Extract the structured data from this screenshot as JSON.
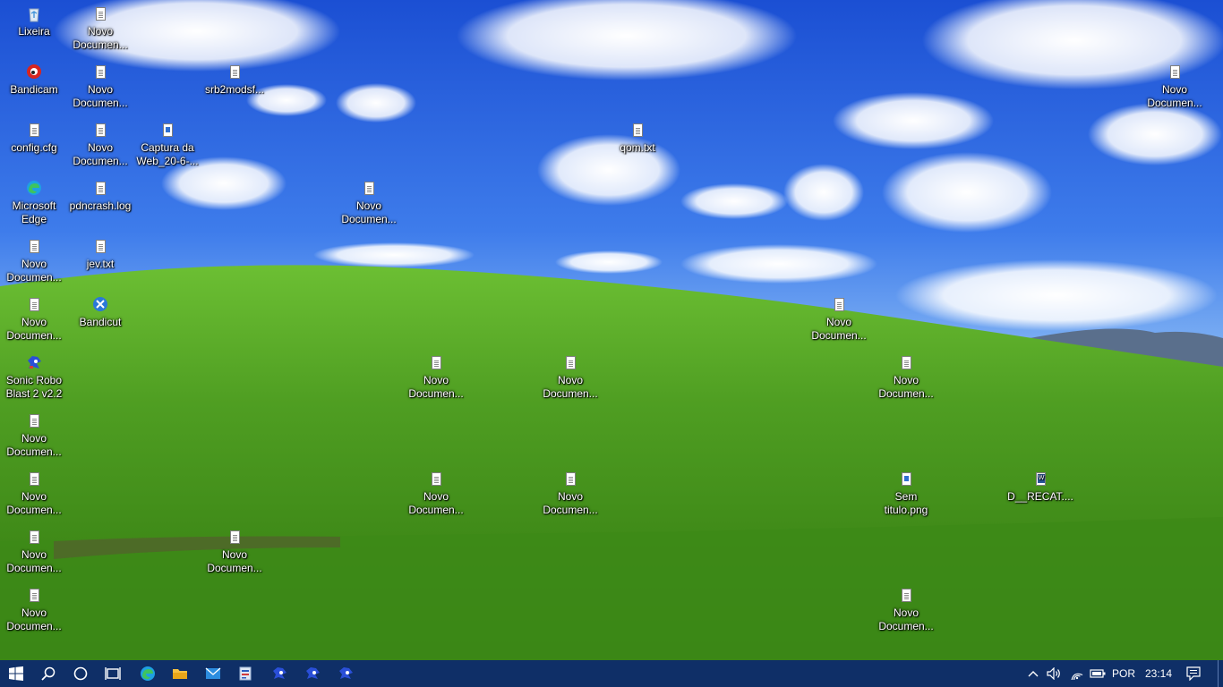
{
  "desktop_icons": [
    {
      "id": "recycle-bin",
      "label": "Lixeira",
      "icon": "recycle-bin-icon",
      "kind": "recycle"
    },
    {
      "id": "doc-1",
      "label": "Novo Documen...",
      "icon": "text-document-icon",
      "kind": "doc"
    },
    {
      "id": "bandicam",
      "label": "Bandicam",
      "icon": "bandicam-icon",
      "kind": "bandicam"
    },
    {
      "id": "doc-2",
      "label": "Novo Documen...",
      "icon": "text-document-icon",
      "kind": "doc"
    },
    {
      "id": "srb2mods",
      "label": "srb2modsf...",
      "icon": "text-document-icon",
      "kind": "doc"
    },
    {
      "id": "doc-top-right",
      "label": "Novo Documen...",
      "icon": "text-document-icon",
      "kind": "doc"
    },
    {
      "id": "config",
      "label": "config.cfg",
      "icon": "text-document-icon",
      "kind": "doc"
    },
    {
      "id": "doc-3",
      "label": "Novo Documen...",
      "icon": "text-document-icon",
      "kind": "doc"
    },
    {
      "id": "captura",
      "label": "Captura da Web_20-6-...",
      "icon": "image-document-icon",
      "kind": "img"
    },
    {
      "id": "qom",
      "label": "qom.txt",
      "icon": "text-document-icon",
      "kind": "doc"
    },
    {
      "id": "edge",
      "label": "Microsoft Edge",
      "icon": "edge-icon",
      "kind": "edge"
    },
    {
      "id": "pdncrash",
      "label": "pdncrash.log",
      "icon": "text-document-icon",
      "kind": "doc"
    },
    {
      "id": "doc-4",
      "label": "Novo Documen...",
      "icon": "text-document-icon",
      "kind": "doc"
    },
    {
      "id": "doc-5",
      "label": "Novo Documen...",
      "icon": "text-document-icon",
      "kind": "doc"
    },
    {
      "id": "jev",
      "label": "jev.txt",
      "icon": "text-document-icon",
      "kind": "doc"
    },
    {
      "id": "doc-6",
      "label": "Novo Documen...",
      "icon": "text-document-icon",
      "kind": "doc"
    },
    {
      "id": "bandicut",
      "label": "Bandicut",
      "icon": "bandicut-icon",
      "kind": "bandicut"
    },
    {
      "id": "doc-7",
      "label": "Novo Documen...",
      "icon": "text-document-icon",
      "kind": "doc"
    },
    {
      "id": "srb2",
      "label": "Sonic Robo Blast 2 v2.2",
      "icon": "sonic-icon",
      "kind": "sonic"
    },
    {
      "id": "doc-8",
      "label": "Novo Documen...",
      "icon": "text-document-icon",
      "kind": "doc"
    },
    {
      "id": "doc-9",
      "label": "Novo Documen...",
      "icon": "text-document-icon",
      "kind": "doc"
    },
    {
      "id": "doc-10",
      "label": "Novo Documen...",
      "icon": "text-document-icon",
      "kind": "doc"
    },
    {
      "id": "doc-11",
      "label": "Novo Documen...",
      "icon": "text-document-icon",
      "kind": "doc"
    },
    {
      "id": "doc-12",
      "label": "Novo Documen...",
      "icon": "text-document-icon",
      "kind": "doc"
    },
    {
      "id": "doc-13",
      "label": "Novo Documen...",
      "icon": "text-document-icon",
      "kind": "doc"
    },
    {
      "id": "doc-14",
      "label": "Novo Documen...",
      "icon": "text-document-icon",
      "kind": "doc"
    },
    {
      "id": "sem-titulo",
      "label": "Sem titulo.png",
      "icon": "image-document-icon",
      "kind": "img"
    },
    {
      "id": "recat",
      "label": "D__RECAT....",
      "icon": "word-document-icon",
      "kind": "word"
    },
    {
      "id": "doc-15",
      "label": "Novo Documen...",
      "icon": "text-document-icon",
      "kind": "doc"
    },
    {
      "id": "doc-16",
      "label": "Novo Documen...",
      "icon": "text-document-icon",
      "kind": "doc"
    },
    {
      "id": "doc-17",
      "label": "Novo Documen...",
      "icon": "text-document-icon",
      "kind": "doc"
    },
    {
      "id": "doc-18",
      "label": "Novo Documen...",
      "icon": "text-document-icon",
      "kind": "doc"
    }
  ],
  "taskbar": {
    "buttons": [
      {
        "id": "start",
        "icon": "windows-start-icon"
      },
      {
        "id": "search",
        "icon": "search-icon"
      },
      {
        "id": "cortana",
        "icon": "cortana-circle-icon"
      },
      {
        "id": "task-view",
        "icon": "task-view-icon"
      },
      {
        "id": "edge",
        "icon": "edge-icon"
      },
      {
        "id": "file-explorer",
        "icon": "folder-icon"
      },
      {
        "id": "mail",
        "icon": "mail-icon"
      },
      {
        "id": "notepad-app",
        "icon": "app-window-icon"
      },
      {
        "id": "sonic-1",
        "icon": "sonic-icon"
      },
      {
        "id": "sonic-2",
        "icon": "sonic-icon"
      },
      {
        "id": "sonic-3",
        "icon": "sonic-icon"
      }
    ],
    "tray": {
      "chevron_icon": "chevron-up-icon",
      "volume_icon": "volume-icon",
      "network_icon": "wifi-icon",
      "power_icon": "battery-icon",
      "language": "POR",
      "time": "23:14",
      "notifications_icon": "action-center-icon"
    }
  },
  "colors": {
    "taskbar_bg": "#0f2f67",
    "sky_top": "#1f55d8",
    "hill_green": "#5aa72c"
  }
}
